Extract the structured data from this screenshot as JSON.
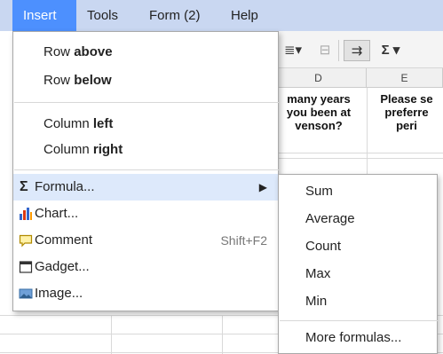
{
  "menubar": {
    "items": [
      {
        "label": "Insert",
        "active": true
      },
      {
        "label": "Tools"
      },
      {
        "label": "Form (2)"
      },
      {
        "label": "Help"
      }
    ]
  },
  "toolbar": {
    "align_icon": "≣▾",
    "merge_icon": "⊟",
    "wrap_icon": "⇉",
    "sigma_icon": "Σ ▾"
  },
  "sheet": {
    "columns": [
      "D",
      "E"
    ],
    "cells": {
      "d1": "many years\nyou been at\nvenson?",
      "e1": "Please se\npreferre\nperi"
    }
  },
  "insert_menu": {
    "row_above": {
      "prefix": "Row ",
      "bold": "above"
    },
    "row_below": {
      "prefix": "Row ",
      "bold": "below"
    },
    "column_left": {
      "prefix": "Column ",
      "bold": "left"
    },
    "column_right": {
      "prefix": "Column ",
      "bold": "right"
    },
    "formula": {
      "label": "Formula...",
      "icon": "sigma-icon",
      "arrow": "▶"
    },
    "chart": {
      "label": "Chart...",
      "icon": "chart-icon"
    },
    "comment": {
      "label": "Comment",
      "icon": "comment-icon",
      "shortcut": "Shift+F2"
    },
    "gadget": {
      "label": "Gadget...",
      "icon": "gadget-icon"
    },
    "image": {
      "label": "Image...",
      "icon": "image-icon"
    }
  },
  "formula_submenu": {
    "items": [
      "Sum",
      "Average",
      "Count",
      "Max",
      "Min"
    ],
    "more": "More formulas..."
  },
  "colors": {
    "menubar_bg": "#c9d7f1",
    "active_menu_bg": "#4d90fe",
    "highlight_bg": "#dde9fb",
    "chart_bars": [
      "#3366cc",
      "#dc3912",
      "#ff9900"
    ],
    "comment_fill": "#fff2a8"
  }
}
